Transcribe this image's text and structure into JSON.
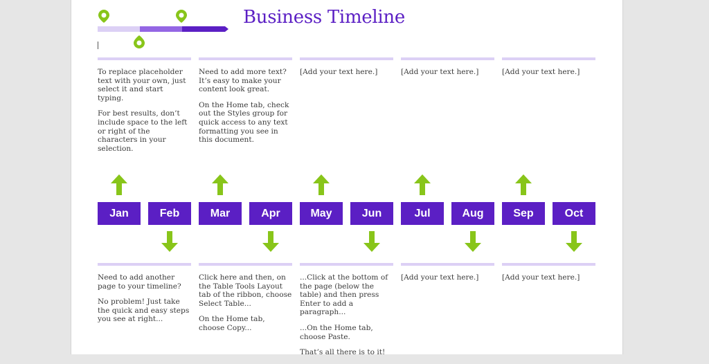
{
  "title": "Business Timeline",
  "colors": {
    "accent": "#5b1fc4",
    "mid": "#9466e4",
    "light": "#dcd0f5",
    "green": "#88c51a"
  },
  "top_blocks": [
    {
      "paragraphs": [
        "To replace placeholder text with your own, just select it and start typing.",
        "For best results, don’t include space to the left or right of the characters in your selection."
      ]
    },
    {
      "paragraphs": [
        "Need to add more text? It’s easy to make your content look great.",
        "On the Home tab, check out the Styles group for quick access to any text formatting you see in this document."
      ]
    },
    {
      "paragraphs": [
        "[Add your text here.]"
      ]
    },
    {
      "paragraphs": [
        "[Add your text here.]"
      ]
    },
    {
      "paragraphs": [
        "[Add your text here.]"
      ]
    }
  ],
  "months": [
    {
      "label": "Jan",
      "arrow": "up"
    },
    {
      "label": "Feb",
      "arrow": "down"
    },
    {
      "label": "Mar",
      "arrow": "up"
    },
    {
      "label": "Apr",
      "arrow": "down"
    },
    {
      "label": "May",
      "arrow": "up"
    },
    {
      "label": "Jun",
      "arrow": "down"
    },
    {
      "label": "Jul",
      "arrow": "up"
    },
    {
      "label": "Aug",
      "arrow": "down"
    },
    {
      "label": "Sep",
      "arrow": "up"
    },
    {
      "label": "Oct",
      "arrow": "down"
    }
  ],
  "bottom_blocks": [
    {
      "paragraphs": [
        "Need to add another page to your timeline?",
        "No problem! Just take the quick and easy steps you see at right..."
      ]
    },
    {
      "paragraphs": [
        "Click here and then, on the Table Tools Layout tab of the ribbon, choose Select Table...",
        "On the Home tab, choose Copy..."
      ]
    },
    {
      "paragraphs": [
        "...Click at the bottom of the page (below the table) and then press Enter to add a paragraph...",
        "...On the Home tab, choose Paste.",
        "That’s all there is to it!"
      ]
    },
    {
      "paragraphs": [
        "[Add your text here.]"
      ]
    },
    {
      "paragraphs": [
        "[Add your text here.]"
      ]
    }
  ]
}
